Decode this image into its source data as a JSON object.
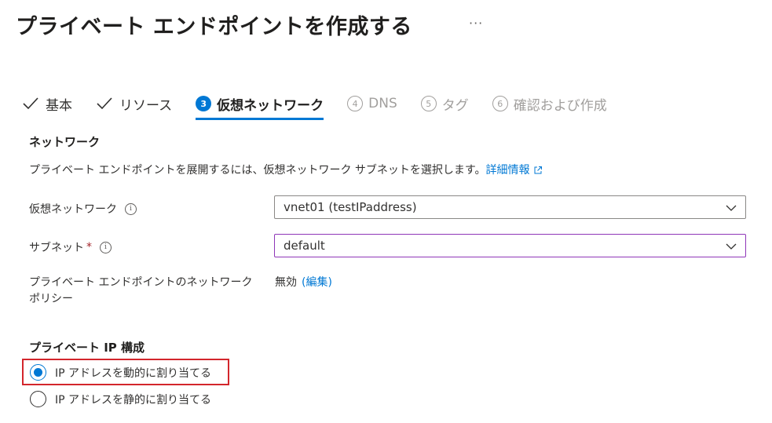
{
  "page": {
    "title": "プライベート エンドポイントを作成する",
    "more_label": "···"
  },
  "tabs": [
    {
      "label": "基本",
      "state": "done"
    },
    {
      "label": "リソース",
      "state": "done"
    },
    {
      "number": "3",
      "label": "仮想ネットワーク",
      "state": "active"
    },
    {
      "number": "4",
      "label": "DNS",
      "state": "todo"
    },
    {
      "number": "5",
      "label": "タグ",
      "state": "todo"
    },
    {
      "number": "6",
      "label": "確認および作成",
      "state": "todo"
    }
  ],
  "network": {
    "heading": "ネットワーク",
    "description": "プライベート エンドポイントを展開するには、仮想ネットワーク サブネットを選択します。",
    "learn_more": "詳細情報",
    "vnet_label": "仮想ネットワーク",
    "vnet_value": "vnet01 (testIPaddress)",
    "subnet_label": "サブネット",
    "subnet_required": "*",
    "subnet_value": "default",
    "policy_label": "プライベート エンドポイントのネットワーク ポリシー",
    "policy_value": "無効",
    "policy_edit": "(編集)"
  },
  "ip_config": {
    "heading": "プライベート IP 構成",
    "options": [
      {
        "label": "IP アドレスを動的に割り当てる",
        "selected": true
      },
      {
        "label": "IP アドレスを静的に割り当てる",
        "selected": false
      }
    ]
  },
  "icons": {
    "info": "info-icon",
    "chevron": "chevron-down-icon",
    "check": "checkmark-icon",
    "external": "external-link-icon"
  },
  "colors": {
    "accent": "#0078d4",
    "required": "#a4262c",
    "focus_border": "#8f36b8",
    "highlight": "#d3262c"
  }
}
